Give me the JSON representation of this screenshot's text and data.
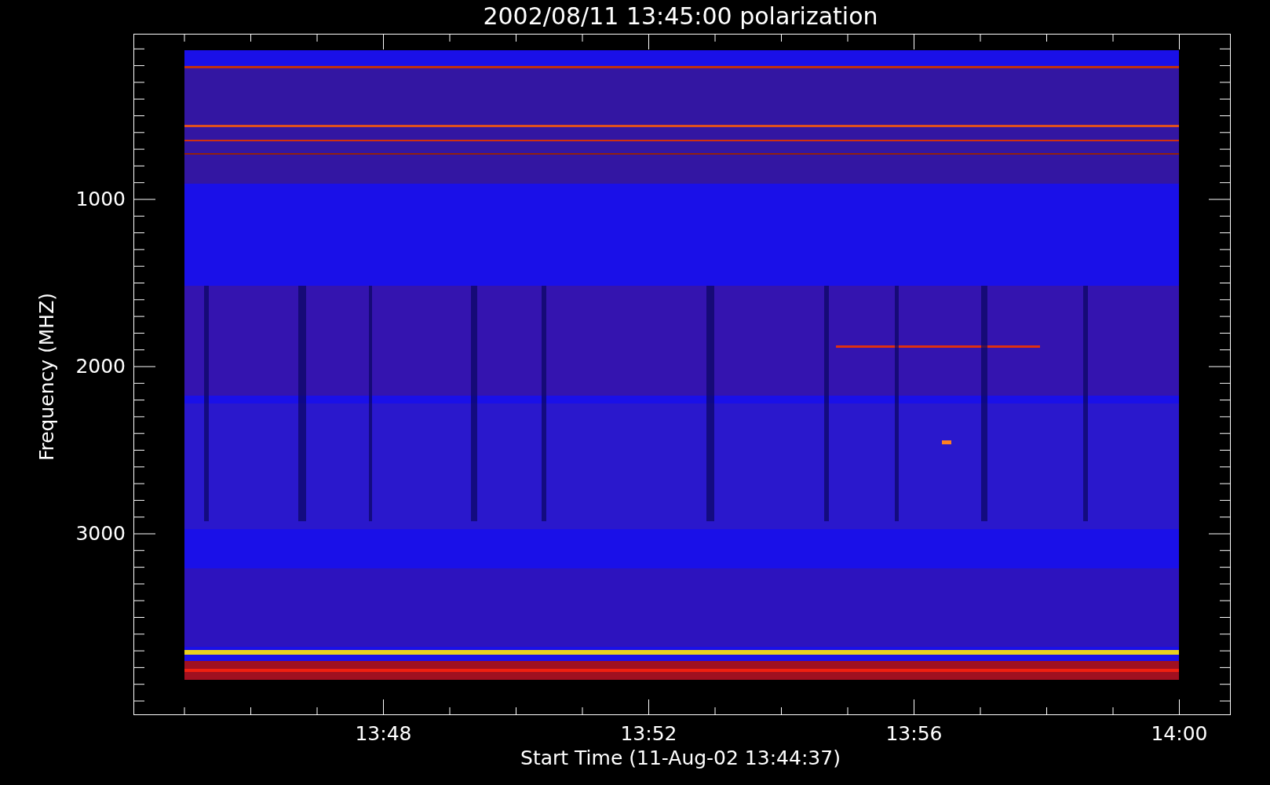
{
  "chart": {
    "title": "2002/08/11 13:45:00 polarization",
    "ylabel": "Frequency (MHZ)",
    "xlabel": "Start Time (11-Aug-02 13:44:37)",
    "yticks": [
      {
        "label": "1000",
        "kind": "major"
      },
      {
        "label": "2000",
        "kind": "major"
      },
      {
        "label": "3000",
        "kind": "major"
      }
    ],
    "xticks": [
      {
        "label": "13:48"
      },
      {
        "label": "13:52"
      },
      {
        "label": "13:56"
      },
      {
        "label": "14:00"
      }
    ]
  }
}
